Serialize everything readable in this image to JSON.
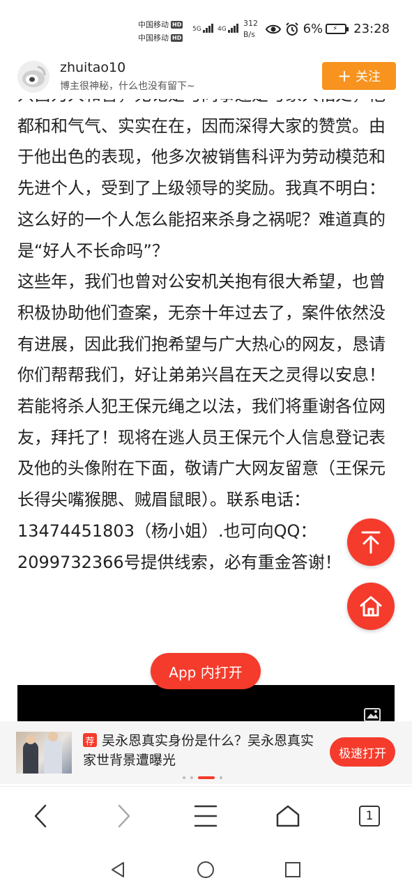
{
  "status_bar": {
    "carrier1": "中国移动",
    "carrier2": "中国移动",
    "hd1": "HD",
    "hd2": "HD",
    "net1": "5G",
    "net2": "4G",
    "speed_value": "312",
    "speed_unit": "B/s",
    "battery": "6%",
    "time": "23:28"
  },
  "profile": {
    "username": "zhuitao10",
    "bio": "博主很神秘，什么也没有留下~",
    "follow_label": "关注"
  },
  "article": {
    "paragraphs": [
      "兴昌为人和善，无论是与同事还是与家人相处，他都和和气气、实实在在，因而深得大家的赞赏。由于他出色的表现，他多次被销售科评为劳动模范和先进个人，受到了上级领导的奖励。我真不明白：这么好的一个人怎么能招来杀身之祸呢？难道真的是“好人不长命吗”？",
      "这些年，我们也曾对公安机关抱有很大希望，也曾积极协助他们查案，无奈十年过去了，案件依然没有进展，因此我们抱希望与广大热心的网友，恳请你们帮帮我们，好让弟弟兴昌在天之灵得以安息！若能将杀人犯王保元绳之以法，我们将重谢各位网友，拜托了！现将在逃人员王保元个人信息登记表及他的头像附在下面，敬请广大网友留意（王保元长得尖嘴猴腮、贼眉鼠眼）。联系电话：13474451803（杨小姐）.也可向QQ：2099732366号提供线索，必有重金答谢！"
    ]
  },
  "app_open_label": "App 内打开",
  "recommend": {
    "badge": "荐",
    "title": "吴永恩真实身份是什么？吴永恩真实家世背景遭曝光",
    "button_label": "极速打开"
  },
  "browser_nav": {
    "tab_count": "1"
  },
  "colors": {
    "accent_red": "#f43b2c",
    "follow_orange": "#f7931e"
  }
}
